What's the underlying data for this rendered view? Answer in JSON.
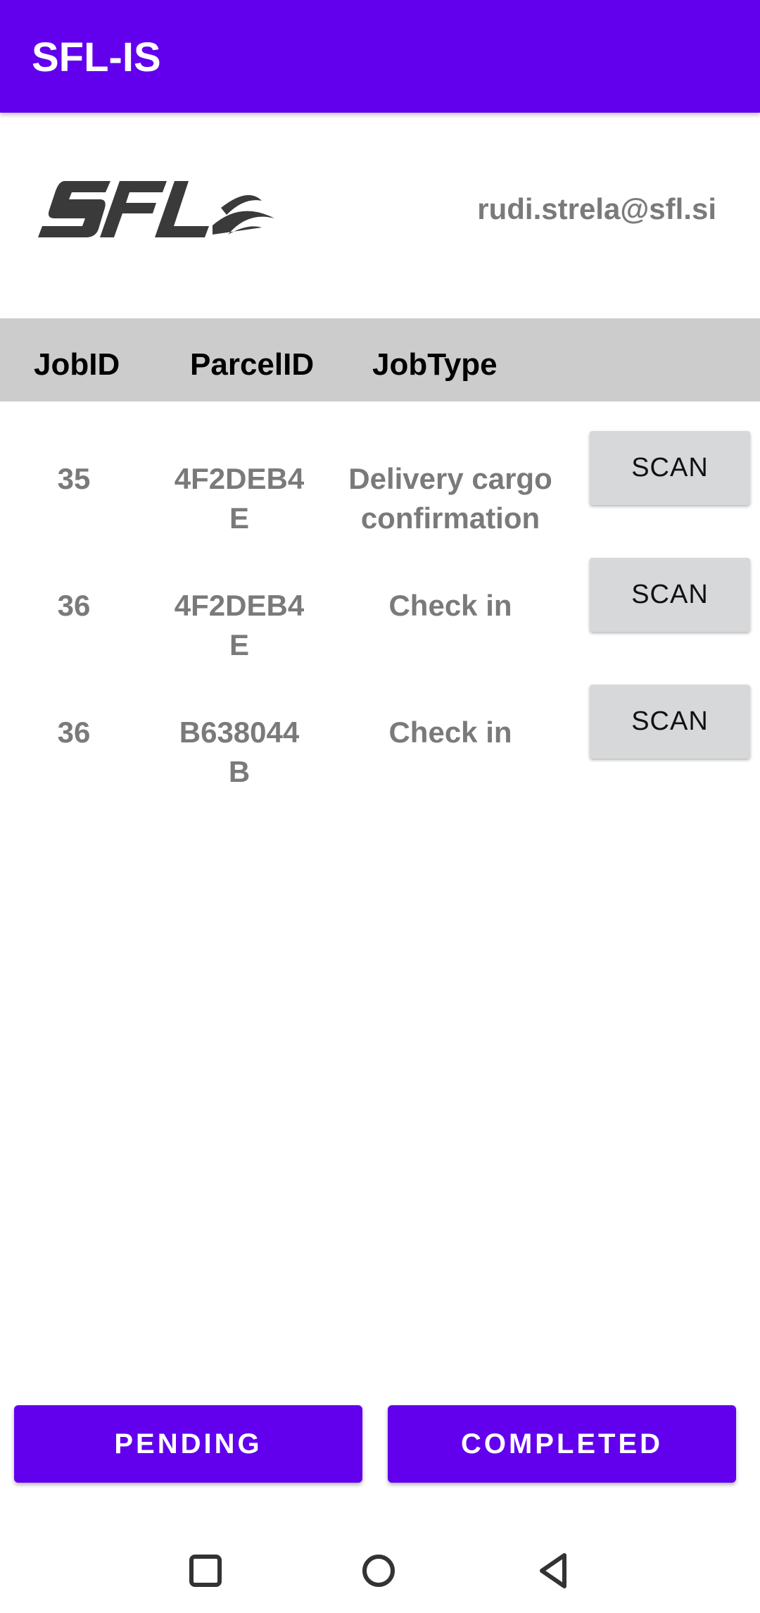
{
  "app_bar": {
    "title": "SFL-IS",
    "color": "#6200ee"
  },
  "header": {
    "logo_name": "sfl-logo",
    "user_email": "rudi.strela@sfl.si"
  },
  "table": {
    "columns": [
      "JobID",
      "ParcelID",
      "JobType"
    ],
    "rows": [
      {
        "job_id": "35",
        "parcel_id_line1": "4F2DEB4",
        "parcel_id_line2": "E",
        "job_type_line1": "Delivery cargo",
        "job_type_line2": "confirmation",
        "action": "SCAN"
      },
      {
        "job_id": "36",
        "parcel_id_line1": "4F2DEB4",
        "parcel_id_line2": "E",
        "job_type_line1": "Check in",
        "job_type_line2": "",
        "action": "SCAN"
      },
      {
        "job_id": "36",
        "parcel_id_line1": "B638044",
        "parcel_id_line2": "B",
        "job_type_line1": "Check in",
        "job_type_line2": "",
        "action": "SCAN"
      }
    ]
  },
  "footer": {
    "pending_label": "PENDING",
    "completed_label": "COMPLETED"
  },
  "nav": {
    "icons": [
      "recent-apps-icon",
      "home-icon",
      "back-icon"
    ]
  }
}
